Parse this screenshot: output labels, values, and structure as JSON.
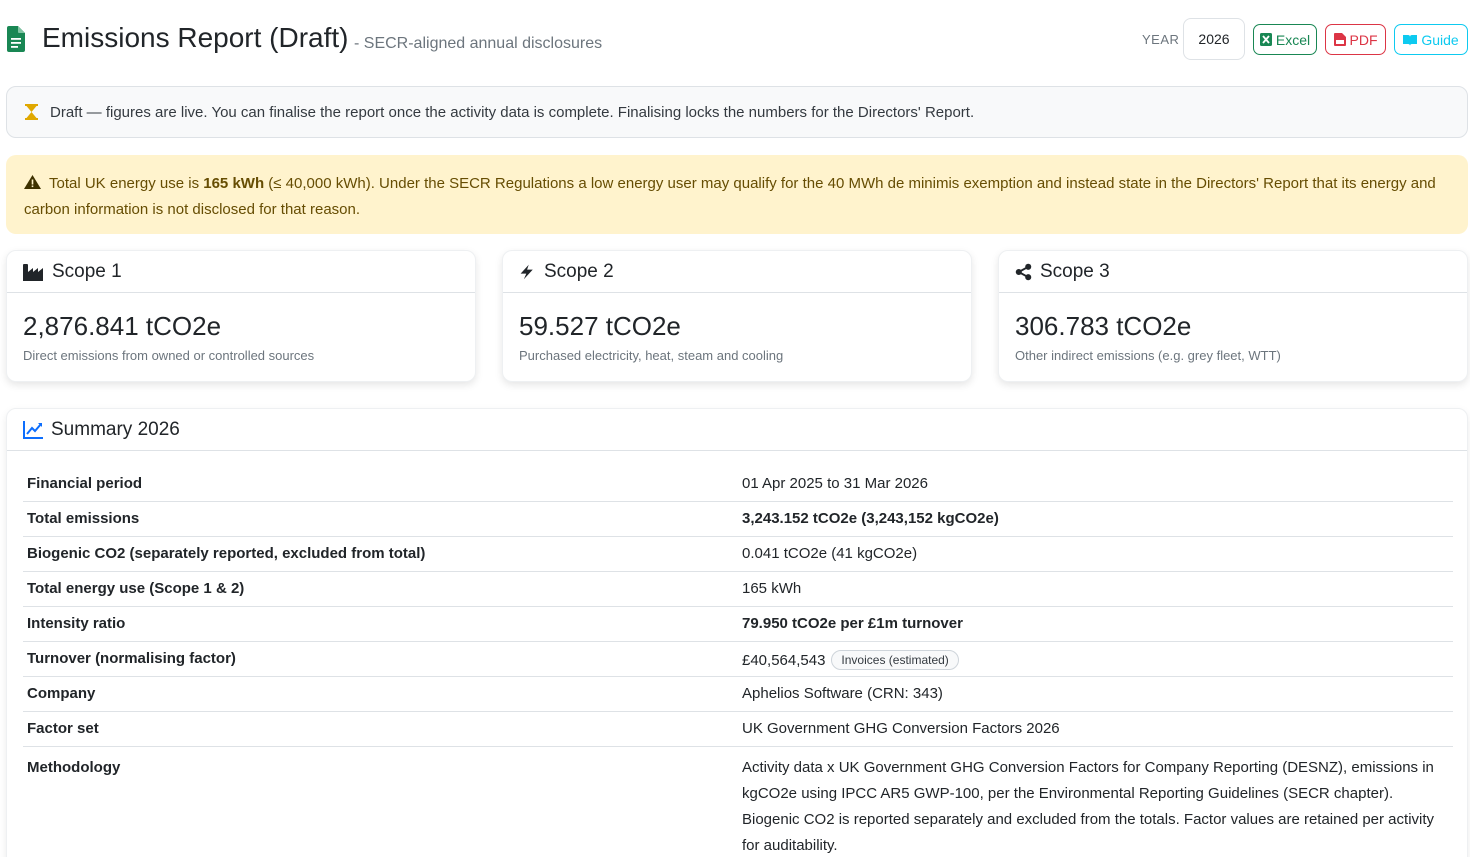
{
  "header": {
    "title": "Emissions Report (Draft)",
    "subtitle": "- SECR-aligned annual disclosures",
    "year_label": "YEAR",
    "year_value": "2026",
    "excel_label": "Excel",
    "pdf_label": "PDF",
    "guide_label": "Guide"
  },
  "draft_banner": {
    "text": "Draft — figures are live. You can finalise the report once the activity data is complete. Finalising locks the numbers for the Directors' Report."
  },
  "warning_banner": {
    "prefix": "Total UK energy use is ",
    "energy": "165 kWh",
    "suffix": " (≤ 40,000 kWh). Under the SECR Regulations a low energy user may qualify for the 40 MWh de minimis exemption and instead state in the Directors' Report that its energy and carbon information is not disclosed for that reason."
  },
  "scopes": [
    {
      "title": "Scope 1",
      "value": "2,876.841 tCO2e",
      "description": "Direct emissions from owned or controlled sources"
    },
    {
      "title": "Scope 2",
      "value": "59.527 tCO2e",
      "description": "Purchased electricity, heat, steam and cooling"
    },
    {
      "title": "Scope 3",
      "value": "306.783 tCO2e",
      "description": "Other indirect emissions (e.g. grey fleet, WTT)"
    }
  ],
  "summary": {
    "title": "Summary 2026",
    "rows": [
      {
        "label": "Financial period",
        "value": "01 Apr 2025 to 31 Mar 2026"
      },
      {
        "label": "Total emissions",
        "value": "3,243.152 tCO2e (3,243,152 kgCO2e)"
      },
      {
        "label": "Biogenic CO2 (separately reported, excluded from total)",
        "value": "0.041 tCO2e (41 kgCO2e)"
      },
      {
        "label": "Total energy use (Scope 1 & 2)",
        "value": "165 kWh"
      },
      {
        "label": "Intensity ratio",
        "value": "79.950 tCO2e per £1m turnover"
      },
      {
        "label": "Turnover (normalising factor)",
        "value": "£40,564,543",
        "badge": "Invoices (estimated)"
      },
      {
        "label": "Company",
        "value": "Aphelios Software (CRN: 343)"
      },
      {
        "label": "Factor set",
        "value": "UK Government GHG Conversion Factors 2026"
      },
      {
        "label": "Methodology",
        "value": "Activity data x UK Government GHG Conversion Factors for Company Reporting (DESNZ), emissions in kgCO2e using IPCC AR5 GWP-100, per the Environmental Reporting Guidelines (SECR chapter). Biogenic CO2 is reported separately and excluded from the totals. Factor values are retained per activity for auditability."
      }
    ]
  },
  "icons": {
    "title": "file-text-icon",
    "draft": "hourglass-icon",
    "warning": "warning-triangle-icon",
    "scope1": "factory-icon",
    "scope2": "lightning-icon",
    "scope3": "share-nodes-icon",
    "summary": "line-chart-icon"
  },
  "colors": {
    "success": "#198754",
    "danger": "#dc3545",
    "info": "#0dcaf0",
    "warning_bg": "#fff3cd",
    "hourglass": "#e0a800",
    "summary_icon": "#0d6efd"
  }
}
